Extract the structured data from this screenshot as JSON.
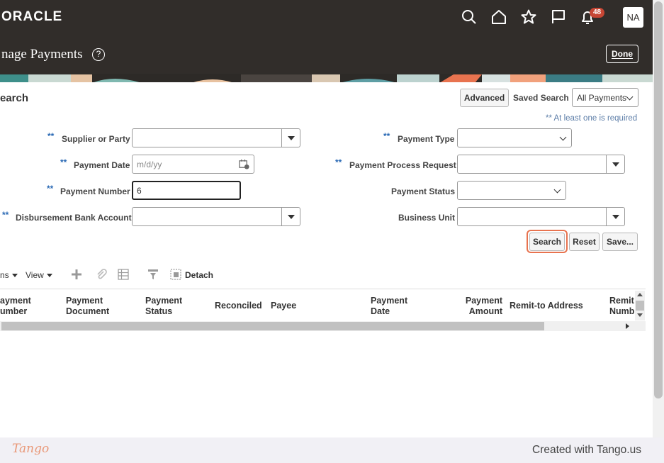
{
  "header": {
    "logo": "ORACLE",
    "notification_count": "48",
    "avatar_initials": "NA",
    "icons": [
      "search-icon",
      "home-icon",
      "star-icon",
      "flag-icon",
      "bell-icon"
    ]
  },
  "title_bar": {
    "title": "nage Payments",
    "help": "?",
    "done_label": "Done"
  },
  "search": {
    "title": "earch",
    "advanced_label": "Advanced",
    "saved_search_label": "Saved Search",
    "saved_search_value": "All Payments",
    "required_note": "** At least one is required",
    "required_marker": "**",
    "fields": {
      "supplier_or_party": {
        "label": "Supplier or Party",
        "value": ""
      },
      "payment_date": {
        "label": "Payment Date",
        "placeholder": "m/d/yy"
      },
      "payment_number": {
        "label": "Payment Number",
        "value": "6"
      },
      "disbursement_bank_account": {
        "label": "Disbursement Bank Account",
        "value": ""
      },
      "payment_type": {
        "label": "Payment Type",
        "value": ""
      },
      "payment_process_request": {
        "label": "Payment Process Request",
        "value": ""
      },
      "payment_status": {
        "label": "Payment Status",
        "value": ""
      },
      "business_unit": {
        "label": "Business Unit",
        "value": ""
      }
    },
    "buttons": {
      "search": "Search",
      "reset": "Reset",
      "save": "Save..."
    }
  },
  "toolbar": {
    "actions_label": "ns",
    "view_label": "View",
    "detach_label": "Detach"
  },
  "table": {
    "columns": [
      [
        "ayment",
        "umber"
      ],
      [
        "Payment",
        "Document"
      ],
      [
        "Payment",
        "Status"
      ],
      [
        "Reconciled"
      ],
      [
        "Payee"
      ],
      [
        "Payment",
        "Date"
      ],
      [
        "Payment",
        "Amount"
      ],
      [
        "Remit-to Address"
      ],
      [
        "Remit",
        "Numb"
      ]
    ]
  },
  "footer": {
    "brand": "Tango",
    "credit": "Created with Tango.us"
  },
  "colors": {
    "header_bg": "#312d2a",
    "badge": "#c74634",
    "required": "#2b6ab5",
    "highlight": "#e8734f",
    "tango": "#e99878"
  }
}
